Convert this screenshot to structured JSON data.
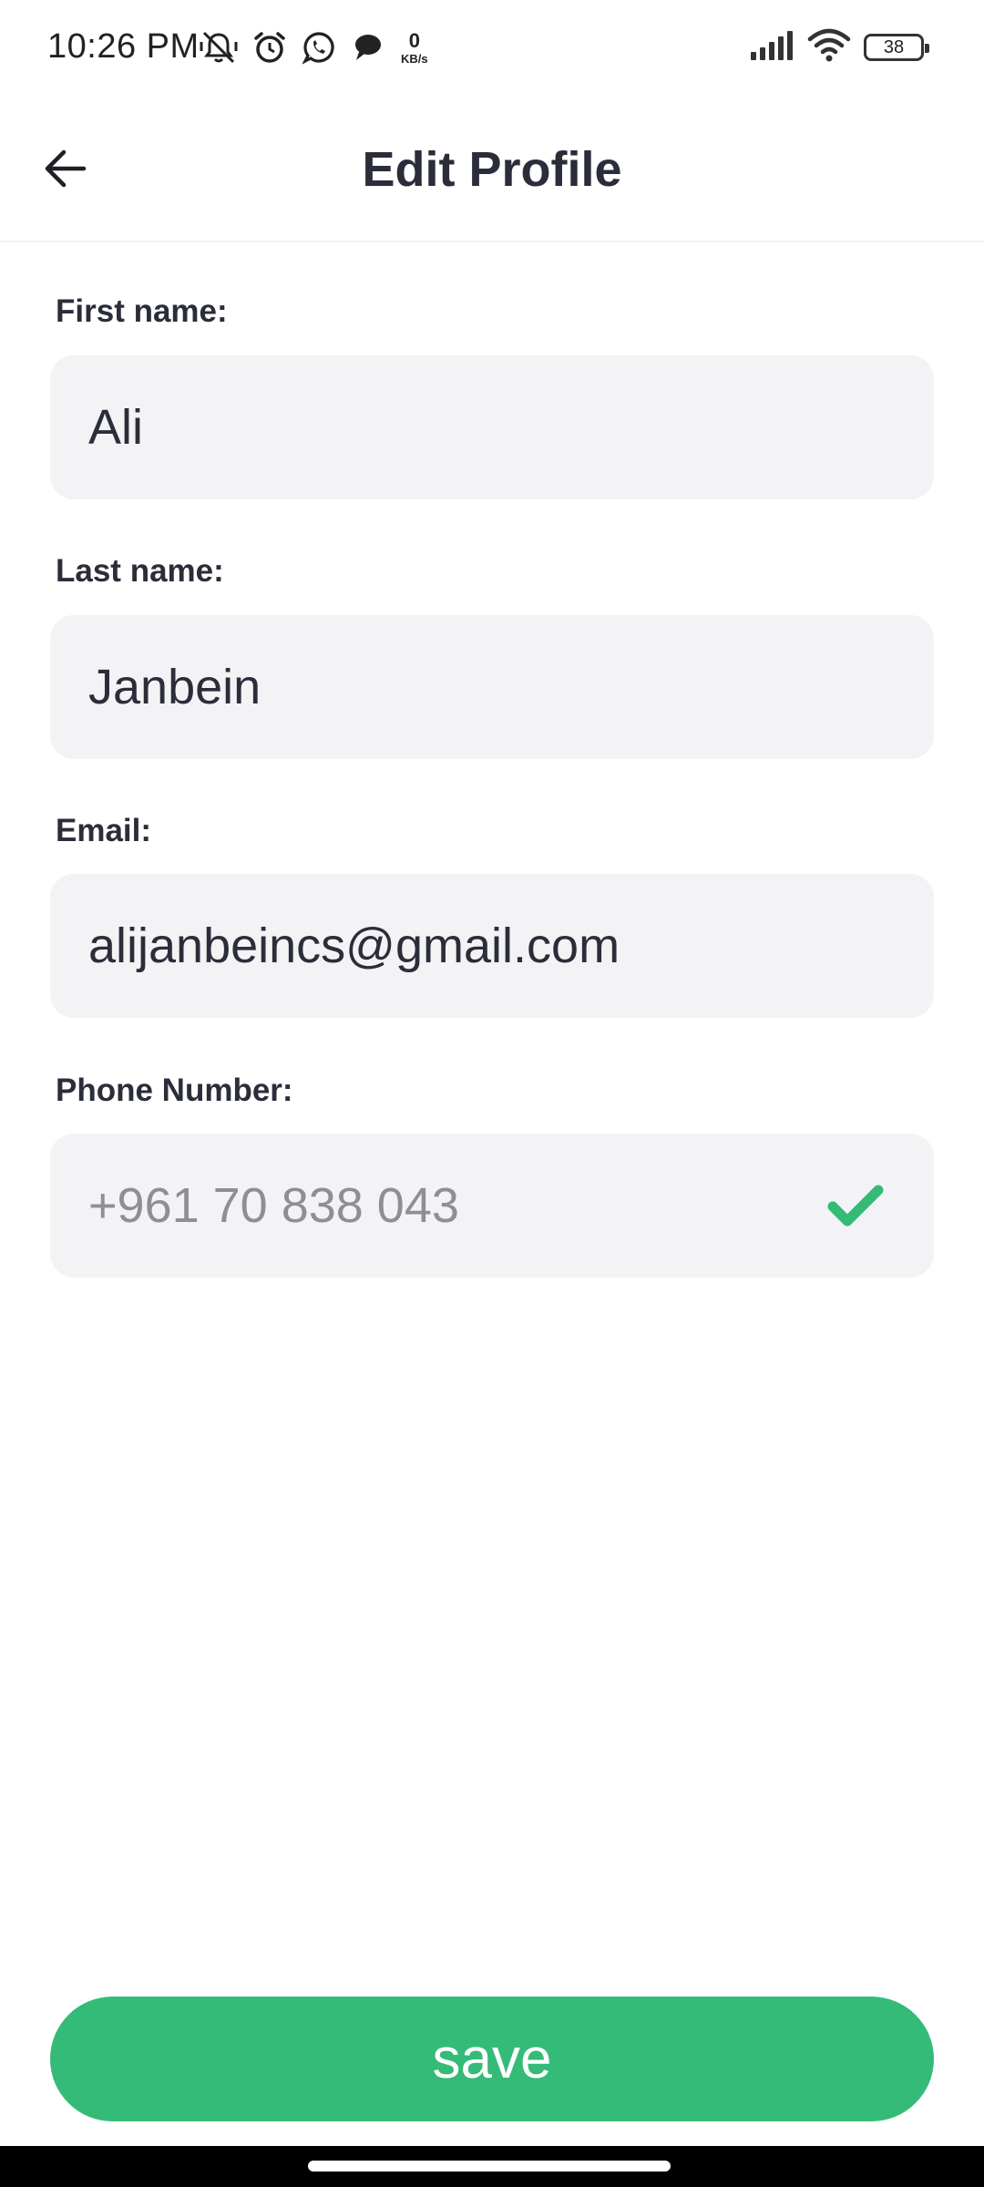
{
  "status_bar": {
    "time": "10:26 PM",
    "net_speed_value": "0",
    "net_speed_unit": "KB/s",
    "battery_level": "38",
    "icons_left": [
      "mute-vibrate-icon",
      "alarm-icon",
      "whatsapp-icon",
      "chat-bubble-icon"
    ],
    "icons_right": [
      "signal-icon",
      "wifi-icon",
      "battery-icon"
    ]
  },
  "header": {
    "title": "Edit Profile",
    "back_icon": "arrow-left-icon"
  },
  "form": {
    "first_name": {
      "label": "First name:",
      "value": "Ali"
    },
    "last_name": {
      "label": "Last name:",
      "value": "Janbein"
    },
    "email": {
      "label": "Email:",
      "value": "alijanbeincs@gmail.com"
    },
    "phone": {
      "label": "Phone Number:",
      "value": "+961 70 838 043",
      "verified_icon": "checkmark-icon"
    }
  },
  "actions": {
    "save_label": "save"
  },
  "colors": {
    "accent": "#34bb77",
    "field_bg": "#f3f3f5",
    "text": "#2b2d3a",
    "muted_text": "#8e8e93"
  }
}
